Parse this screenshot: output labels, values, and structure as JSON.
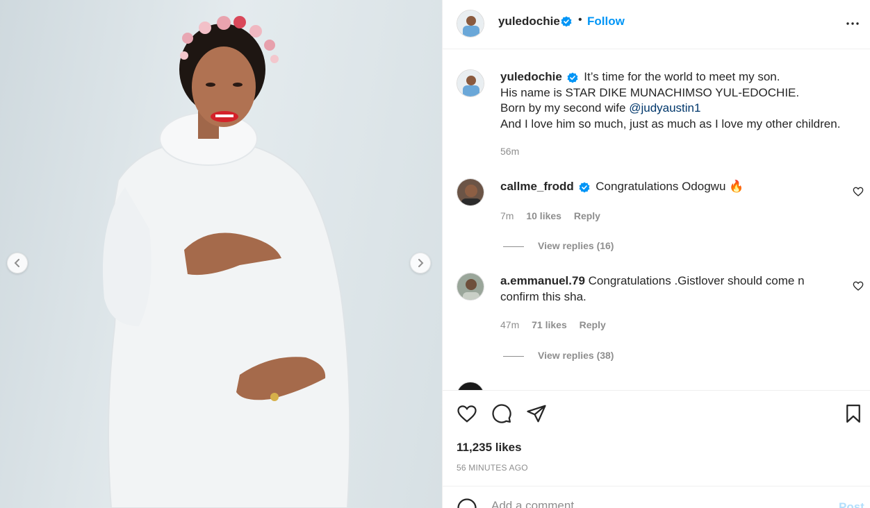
{
  "post": {
    "author": "yuledochie",
    "follow_label": "Follow",
    "dot": "•",
    "verified_color": "#0095f6"
  },
  "caption": {
    "author": "yuledochie",
    "line1": "It’s time for the world to meet my son.",
    "line2": "His name is STAR DIKE MUNACHIMSO YUL-EDOCHIE.",
    "line3_prefix": "Born by my second wife ",
    "mention": "@judyaustin1",
    "line4": "And I love him so much, just as much as I love my other children.",
    "time": "56m"
  },
  "comments": [
    {
      "author": "callme_frodd",
      "verified": true,
      "text": "Congratulations Odogwu 🔥",
      "time": "7m",
      "likes": "10 likes",
      "reply": "Reply",
      "view_replies": "View replies (16)"
    },
    {
      "author": "a.emmanuel.79",
      "verified": false,
      "text": "Congratulations .Gistlover should come n confirm this sha.",
      "time": "47m",
      "likes": "71 likes",
      "reply": "Reply",
      "view_replies": "View replies (38)"
    }
  ],
  "footer": {
    "likes": "11,235 likes",
    "time_ago": "56 MINUTES AGO",
    "comment_placeholder": "Add a comment…",
    "post_label": "Post"
  },
  "colors": {
    "accent": "#0095f6",
    "muted": "#8e8e8e",
    "mention": "#00376b"
  },
  "icons": [
    "verified-badge-icon",
    "more-options-icon",
    "chevron-left-icon",
    "chevron-right-icon",
    "heart-icon",
    "comment-icon",
    "share-icon",
    "bookmark-icon",
    "emoji-icon"
  ]
}
